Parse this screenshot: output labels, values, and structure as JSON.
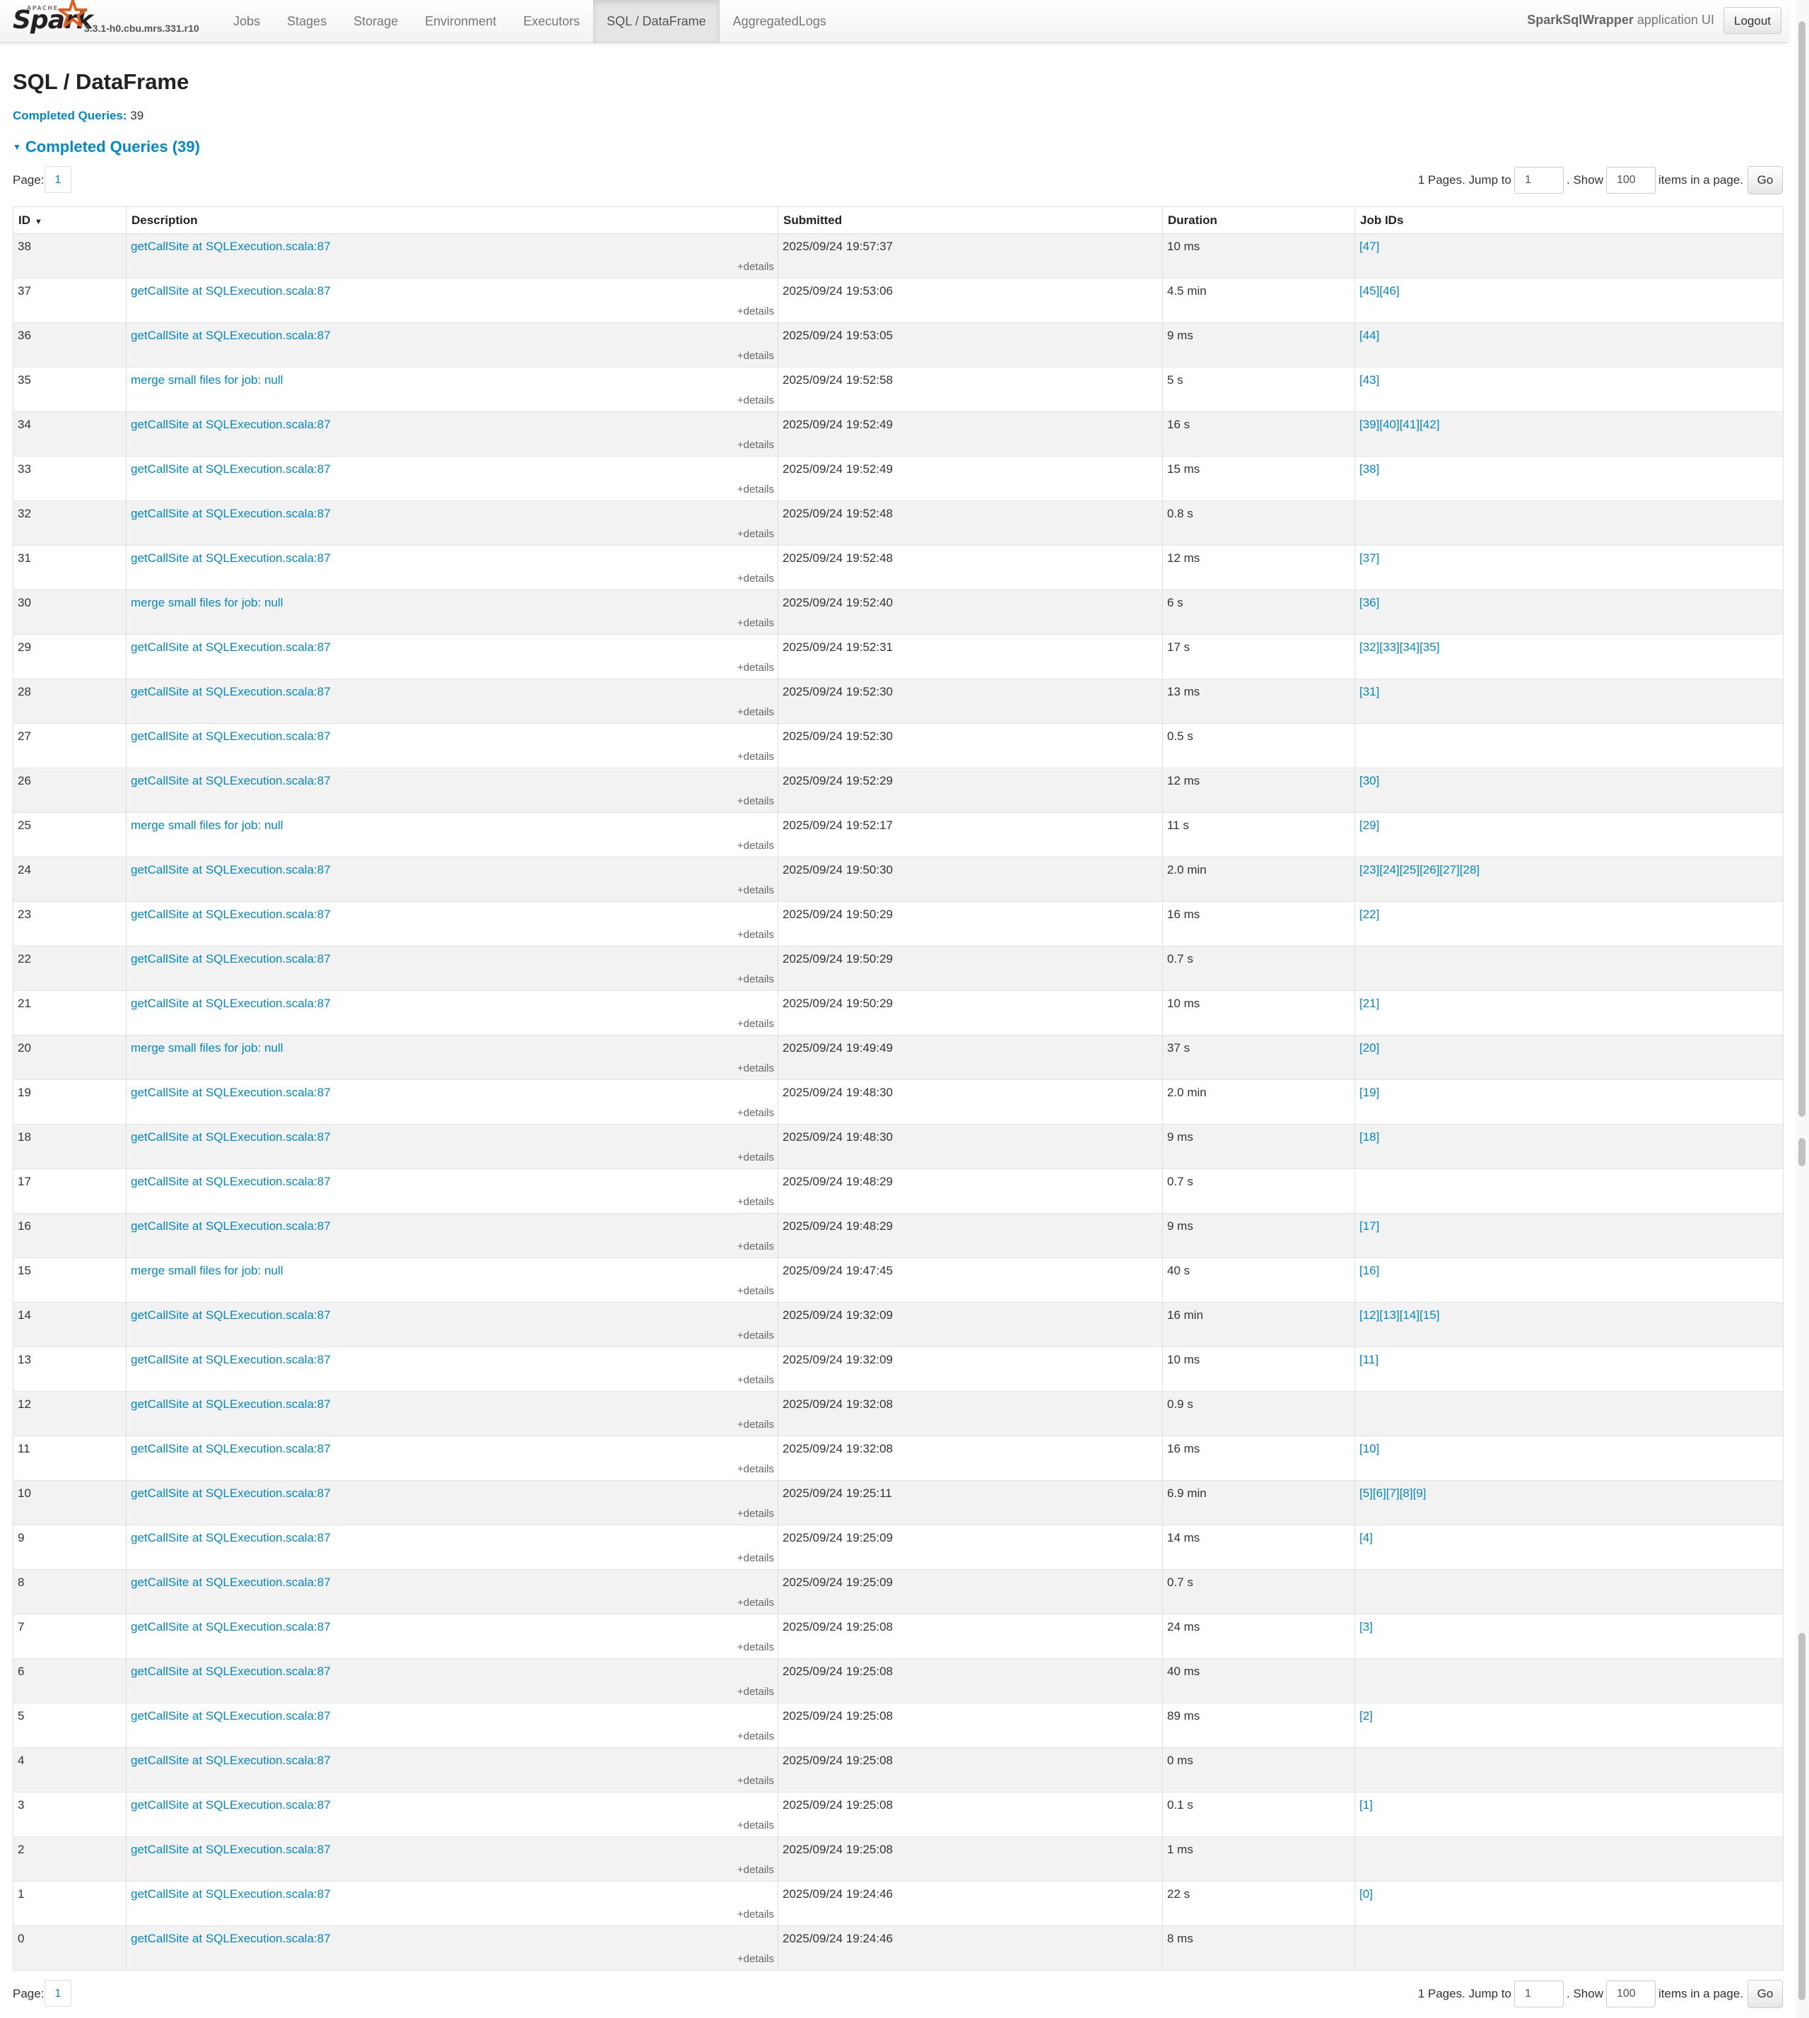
{
  "brand": {
    "apache": "APACHE",
    "name": "Spark",
    "version": "3.3.1-h0.cbu.mrs.331.r10"
  },
  "nav": [
    {
      "label": "Jobs",
      "active": false
    },
    {
      "label": "Stages",
      "active": false
    },
    {
      "label": "Storage",
      "active": false
    },
    {
      "label": "Environment",
      "active": false
    },
    {
      "label": "Executors",
      "active": false
    },
    {
      "label": "SQL / DataFrame",
      "active": true
    },
    {
      "label": "AggregatedLogs",
      "active": false
    }
  ],
  "header": {
    "app_name": "SparkSqlWrapper",
    "app_suffix": "application UI",
    "logout_label": "Logout"
  },
  "page": {
    "title": "SQL / DataFrame",
    "summary_label": "Completed Queries:",
    "summary_value": "39",
    "section_title": "Completed Queries (39)"
  },
  "pagination": {
    "page_label": "Page:",
    "current_page": "1",
    "pages_text": "1 Pages. Jump to",
    "jump_value": "1",
    "show_text": ". Show",
    "page_size": "100",
    "items_text": "items in a page.",
    "go_label": "Go"
  },
  "table": {
    "columns": [
      "ID",
      "Description",
      "Submitted",
      "Duration",
      "Job IDs"
    ],
    "details_label": "+details",
    "rows": [
      {
        "id": "38",
        "desc": "getCallSite at SQLExecution.scala:87",
        "submitted": "2025/09/24 19:57:37",
        "duration": "10 ms",
        "jobs": "[47]"
      },
      {
        "id": "37",
        "desc": "getCallSite at SQLExecution.scala:87",
        "submitted": "2025/09/24 19:53:06",
        "duration": "4.5 min",
        "jobs": "[45][46]"
      },
      {
        "id": "36",
        "desc": "getCallSite at SQLExecution.scala:87",
        "submitted": "2025/09/24 19:53:05",
        "duration": "9 ms",
        "jobs": "[44]"
      },
      {
        "id": "35",
        "desc": "merge small files for job: null",
        "submitted": "2025/09/24 19:52:58",
        "duration": "5 s",
        "jobs": "[43]"
      },
      {
        "id": "34",
        "desc": "getCallSite at SQLExecution.scala:87",
        "submitted": "2025/09/24 19:52:49",
        "duration": "16 s",
        "jobs": "[39][40][41][42]"
      },
      {
        "id": "33",
        "desc": "getCallSite at SQLExecution.scala:87",
        "submitted": "2025/09/24 19:52:49",
        "duration": "15 ms",
        "jobs": "[38]"
      },
      {
        "id": "32",
        "desc": "getCallSite at SQLExecution.scala:87",
        "submitted": "2025/09/24 19:52:48",
        "duration": "0.8 s",
        "jobs": ""
      },
      {
        "id": "31",
        "desc": "getCallSite at SQLExecution.scala:87",
        "submitted": "2025/09/24 19:52:48",
        "duration": "12 ms",
        "jobs": "[37]"
      },
      {
        "id": "30",
        "desc": "merge small files for job: null",
        "submitted": "2025/09/24 19:52:40",
        "duration": "6 s",
        "jobs": "[36]"
      },
      {
        "id": "29",
        "desc": "getCallSite at SQLExecution.scala:87",
        "submitted": "2025/09/24 19:52:31",
        "duration": "17 s",
        "jobs": "[32][33][34][35]"
      },
      {
        "id": "28",
        "desc": "getCallSite at SQLExecution.scala:87",
        "submitted": "2025/09/24 19:52:30",
        "duration": "13 ms",
        "jobs": "[31]"
      },
      {
        "id": "27",
        "desc": "getCallSite at SQLExecution.scala:87",
        "submitted": "2025/09/24 19:52:30",
        "duration": "0.5 s",
        "jobs": ""
      },
      {
        "id": "26",
        "desc": "getCallSite at SQLExecution.scala:87",
        "submitted": "2025/09/24 19:52:29",
        "duration": "12 ms",
        "jobs": "[30]"
      },
      {
        "id": "25",
        "desc": "merge small files for job: null",
        "submitted": "2025/09/24 19:52:17",
        "duration": "11 s",
        "jobs": "[29]"
      },
      {
        "id": "24",
        "desc": "getCallSite at SQLExecution.scala:87",
        "submitted": "2025/09/24 19:50:30",
        "duration": "2.0 min",
        "jobs": "[23][24][25][26][27][28]"
      },
      {
        "id": "23",
        "desc": "getCallSite at SQLExecution.scala:87",
        "submitted": "2025/09/24 19:50:29",
        "duration": "16 ms",
        "jobs": "[22]"
      },
      {
        "id": "22",
        "desc": "getCallSite at SQLExecution.scala:87",
        "submitted": "2025/09/24 19:50:29",
        "duration": "0.7 s",
        "jobs": ""
      },
      {
        "id": "21",
        "desc": "getCallSite at SQLExecution.scala:87",
        "submitted": "2025/09/24 19:50:29",
        "duration": "10 ms",
        "jobs": "[21]"
      },
      {
        "id": "20",
        "desc": "merge small files for job: null",
        "submitted": "2025/09/24 19:49:49",
        "duration": "37 s",
        "jobs": "[20]"
      },
      {
        "id": "19",
        "desc": "getCallSite at SQLExecution.scala:87",
        "submitted": "2025/09/24 19:48:30",
        "duration": "2.0 min",
        "jobs": "[19]"
      },
      {
        "id": "18",
        "desc": "getCallSite at SQLExecution.scala:87",
        "submitted": "2025/09/24 19:48:30",
        "duration": "9 ms",
        "jobs": "[18]"
      },
      {
        "id": "17",
        "desc": "getCallSite at SQLExecution.scala:87",
        "submitted": "2025/09/24 19:48:29",
        "duration": "0.7 s",
        "jobs": ""
      },
      {
        "id": "16",
        "desc": "getCallSite at SQLExecution.scala:87",
        "submitted": "2025/09/24 19:48:29",
        "duration": "9 ms",
        "jobs": "[17]"
      },
      {
        "id": "15",
        "desc": "merge small files for job: null",
        "submitted": "2025/09/24 19:47:45",
        "duration": "40 s",
        "jobs": "[16]"
      },
      {
        "id": "14",
        "desc": "getCallSite at SQLExecution.scala:87",
        "submitted": "2025/09/24 19:32:09",
        "duration": "16 min",
        "jobs": "[12][13][14][15]"
      },
      {
        "id": "13",
        "desc": "getCallSite at SQLExecution.scala:87",
        "submitted": "2025/09/24 19:32:09",
        "duration": "10 ms",
        "jobs": "[11]"
      },
      {
        "id": "12",
        "desc": "getCallSite at SQLExecution.scala:87",
        "submitted": "2025/09/24 19:32:08",
        "duration": "0.9 s",
        "jobs": ""
      },
      {
        "id": "11",
        "desc": "getCallSite at SQLExecution.scala:87",
        "submitted": "2025/09/24 19:32:08",
        "duration": "16 ms",
        "jobs": "[10]"
      },
      {
        "id": "10",
        "desc": "getCallSite at SQLExecution.scala:87",
        "submitted": "2025/09/24 19:25:11",
        "duration": "6.9 min",
        "jobs": "[5][6][7][8][9]"
      },
      {
        "id": "9",
        "desc": "getCallSite at SQLExecution.scala:87",
        "submitted": "2025/09/24 19:25:09",
        "duration": "14 ms",
        "jobs": "[4]"
      },
      {
        "id": "8",
        "desc": "getCallSite at SQLExecution.scala:87",
        "submitted": "2025/09/24 19:25:09",
        "duration": "0.7 s",
        "jobs": ""
      },
      {
        "id": "7",
        "desc": "getCallSite at SQLExecution.scala:87",
        "submitted": "2025/09/24 19:25:08",
        "duration": "24 ms",
        "jobs": "[3]"
      },
      {
        "id": "6",
        "desc": "getCallSite at SQLExecution.scala:87",
        "submitted": "2025/09/24 19:25:08",
        "duration": "40 ms",
        "jobs": ""
      },
      {
        "id": "5",
        "desc": "getCallSite at SQLExecution.scala:87",
        "submitted": "2025/09/24 19:25:08",
        "duration": "89 ms",
        "jobs": "[2]"
      },
      {
        "id": "4",
        "desc": "getCallSite at SQLExecution.scala:87",
        "submitted": "2025/09/24 19:25:08",
        "duration": "0 ms",
        "jobs": ""
      },
      {
        "id": "3",
        "desc": "getCallSite at SQLExecution.scala:87",
        "submitted": "2025/09/24 19:25:08",
        "duration": "0.1 s",
        "jobs": "[1]"
      },
      {
        "id": "2",
        "desc": "getCallSite at SQLExecution.scala:87",
        "submitted": "2025/09/24 19:25:08",
        "duration": "1 ms",
        "jobs": ""
      },
      {
        "id": "1",
        "desc": "getCallSite at SQLExecution.scala:87",
        "submitted": "2025/09/24 19:24:46",
        "duration": "22 s",
        "jobs": "[0]"
      },
      {
        "id": "0",
        "desc": "getCallSite at SQLExecution.scala:87",
        "submitted": "2025/09/24 19:24:46",
        "duration": "8 ms",
        "jobs": ""
      }
    ]
  },
  "colors": {
    "link": "#0088cc",
    "row_alt": "#f2f2f2",
    "nav_active": "#e5e5e5",
    "spark_orange": "#e25a1c"
  }
}
